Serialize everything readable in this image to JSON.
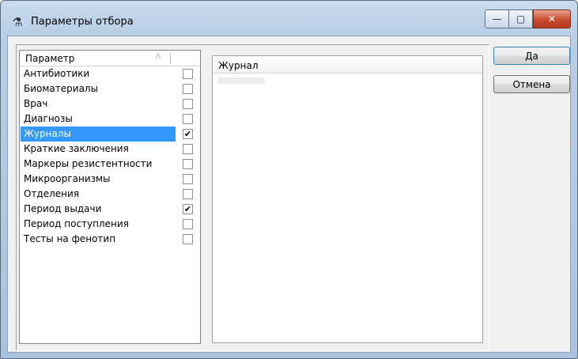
{
  "window": {
    "title": "Параметры отбора",
    "controls": {
      "minimize": "—",
      "maximize": "▢",
      "close": "✕"
    }
  },
  "params": {
    "header": "Параметр",
    "sort_indicator": "/\\",
    "items": [
      {
        "label": "Антибиотики",
        "checked": false,
        "selected": false
      },
      {
        "label": "Биоматериалы",
        "checked": false,
        "selected": false
      },
      {
        "label": "Врач",
        "checked": false,
        "selected": false
      },
      {
        "label": "Диагнозы",
        "checked": false,
        "selected": false
      },
      {
        "label": "Журналы",
        "checked": true,
        "selected": true
      },
      {
        "label": "Краткие заключения",
        "checked": false,
        "selected": false
      },
      {
        "label": "Маркеры резистентности",
        "checked": false,
        "selected": false
      },
      {
        "label": "Микроорганизмы",
        "checked": false,
        "selected": false
      },
      {
        "label": "Отделения",
        "checked": false,
        "selected": false
      },
      {
        "label": "Период выдачи",
        "checked": true,
        "selected": false
      },
      {
        "label": "Период поступления",
        "checked": false,
        "selected": false
      },
      {
        "label": "Тесты на фенотип",
        "checked": false,
        "selected": false
      }
    ]
  },
  "journal": {
    "header": "Журнал"
  },
  "buttons": {
    "ok": "Да",
    "cancel": "Отмена"
  },
  "colors": {
    "selection": "#3399ff",
    "close_button": "#c84a2f"
  }
}
